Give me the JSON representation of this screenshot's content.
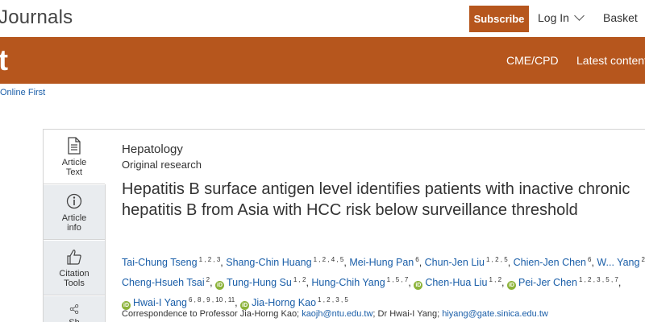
{
  "header": {
    "brand": "Journals",
    "subscribe_label": "Subscribe",
    "login_label": "Log In",
    "basket_label": "Basket"
  },
  "banner": {
    "letter": "t",
    "nav": [
      "CME/CPD",
      "Latest content"
    ]
  },
  "breadcrumb": "Online First",
  "side_tabs": [
    {
      "label": "Article Text",
      "icon": "document-icon",
      "active": true
    },
    {
      "label": "Article info",
      "icon": "info-icon",
      "active": false
    },
    {
      "label": "Citation Tools",
      "icon": "thumbs-up-icon",
      "active": false
    },
    {
      "label": "Sh",
      "icon": "share-icon",
      "active": false
    }
  ],
  "article": {
    "subject": "Hepatology",
    "type": "Original research",
    "title": "Hepatitis B surface antigen level identifies patients with inactive chronic hepatitis B from Asia with HCC risk below surveillance threshold",
    "authors": [
      {
        "name": "Tai-Chung Tseng",
        "aff": "1 , 2 , 3",
        "orcid": false
      },
      {
        "name": "Shang-Chin Huang",
        "aff": "1 , 2 , 4 , 5",
        "orcid": false
      },
      {
        "name": "Mei-Hung Pan",
        "aff": "6",
        "orcid": false
      },
      {
        "name": "Chun-Jen Liu",
        "aff": "1 , 2 , 5",
        "orcid": false
      },
      {
        "name": "Chien-Jen Chen",
        "aff": "6",
        "orcid": false
      },
      {
        "name": "W... Yang",
        "aff": "2",
        "orcid": false
      },
      {
        "name": "Cheng-Hsueh Tsai",
        "aff": "2",
        "orcid": false
      },
      {
        "name": "Tung-Hung Su",
        "aff": "1 , 2",
        "orcid": true
      },
      {
        "name": "Hung-Chih Yang",
        "aff": "1 , 5 , 7",
        "orcid": false
      },
      {
        "name": "Chen-Hua Liu",
        "aff": "1 , 2",
        "orcid": true
      },
      {
        "name": "Pei-Jer Chen",
        "aff": "1 , 2 , 3 , 5 , 7",
        "orcid": true
      },
      {
        "name": "Hwai-I Yang",
        "aff": "6 , 8 , 9 , 10 , 11",
        "orcid": true
      },
      {
        "name": "Jia-Horng Kao",
        "aff": "1 , 2 , 3 , 5",
        "orcid": true
      }
    ],
    "correspondence": {
      "prefix": "Correspondence to Professor Jia-Horng Kao;",
      "email1": "kaojh@ntu.edu.tw",
      "middle": "; Dr Hwai-I Yang;",
      "email2": "hiyang@gate.sinica.edu.tw"
    }
  },
  "colors": {
    "brand_orange": "#b6561d",
    "link_blue": "#1a5ea8",
    "orcid_green": "#8cb33a",
    "tab_gray": "#e9ecef"
  }
}
